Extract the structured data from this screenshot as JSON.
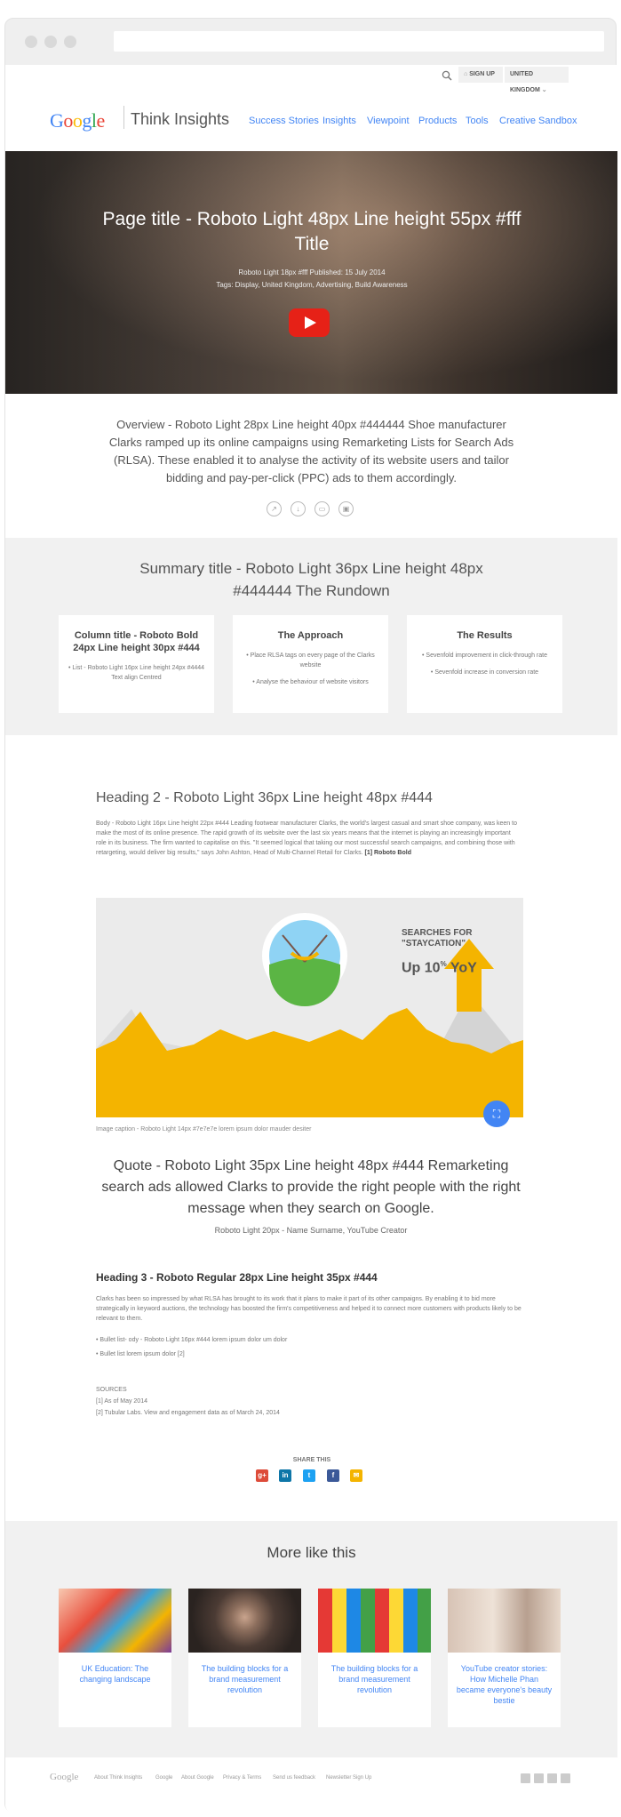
{
  "header": {
    "sign_up": "SIGN UP",
    "region": "UNITED KINGDOM",
    "logo": [
      "G",
      "o",
      "o",
      "g",
      "l",
      "e"
    ],
    "brand": "Think Insights",
    "nav": [
      "Success Stories",
      "Insights",
      "Viewpoint",
      "Products",
      "Tools",
      "Creative Sandbox"
    ]
  },
  "hero": {
    "title": "Page title - Roboto Light 48px Line height 55px #fff Title",
    "meta_line1": "Roboto Light 18px #fff Published: 15 July 2014",
    "meta_line2": "Tags: Display, United Kingdom, Advertising, Build Awareness"
  },
  "overview": "Overview - Roboto Light 28px Line height 40px #444444 Shoe manufacturer Clarks ramped up its online campaigns using Remarketing Lists for Search Ads (RLSA). These enabled it to analyse the activity of its website users and tailor bidding and pay-per-click (PPC) ads to them accordingly.",
  "summary": {
    "title": "Summary title - Roboto Light 36px Line height 48px #444444 The Rundown",
    "cards": [
      {
        "title": "Column title - Roboto Bold 24px  Line height 30px #444",
        "items": [
          "• List - Roboto Light 16px Line height 24px #4444 Text align Centred"
        ]
      },
      {
        "title": "The Approach",
        "items": [
          "• Place RLSA tags on every page of the Clarks website",
          "• Analyse the behaviour of website visitors"
        ]
      },
      {
        "title": "The Results",
        "items": [
          "• Sevenfold improvement in click-through rate",
          "• Sevenfold increase in conversion rate"
        ]
      }
    ]
  },
  "article": {
    "h2": "Heading 2 - Roboto Light 36px Line height 48px #444",
    "body": "Body - Roboto Light 16px Line height 22px #444 Leading footwear manufacturer Clarks, the world's largest casual and smart shoe company, was keen to make the most of its online presence. The rapid growth of its website over the last six years means that the internet is playing an increasingly important role in its business. The firm wanted to capitalise on this. \"It seemed logical that taking our most successful search campaigns, and combining those with retargeting, would deliver big results,\" says John Ashton, Head of Multi-Channel Retail for Clarks.",
    "body_ref": "[1] Roboto Bold",
    "infographic": {
      "label1": "SEARCHES FOR",
      "label2": "\"STAYCATION\"",
      "stat": "Up 10",
      "stat_sup": "%",
      "stat_tail": " YoY"
    },
    "caption": "Image caption - Roboto Light 14px #7e7e7e lorem ipsum dolor mauder desiter",
    "quote": "Quote - Roboto Light 35px  Line height 48px #444 Remarketing search ads allowed Clarks to provide the right people with the right message when they search on Google.",
    "quote_by": "Roboto Light 20px - Name Surname, YouTube Creator",
    "h3": "Heading 3 - Roboto Regular 28px Line height 35px #444",
    "body3": "Clarks has been so impressed by what RLSA has brought to its work that it plans to make it part of its other campaigns. By enabling it to bid more strategically in keyword auctions, the technology has boosted the firm's competitiveness and helped it to connect more customers with products likely to be relevant to them.",
    "bullet1": "• Bullet list- ody - Roboto Light 16px #444 lorem ipsum dolor um dolor",
    "bullet2": "• Bullet list lorem ipsum dolor [2]",
    "sources_label": "SOURCES",
    "source1": "[1] As of May 2014",
    "source2": "[2] Tubular Labs. View and engagement data as of March 24, 2014"
  },
  "share": {
    "label": "SHARE THIS",
    "icons": [
      "g+",
      "in",
      "t",
      "f",
      "✉"
    ],
    "colors": [
      "#dd4b39",
      "#0e76a8",
      "#1da1f2",
      "#3b5998",
      "#f4b400"
    ]
  },
  "more": {
    "title": "More like this",
    "items": [
      {
        "title": "UK Education: The changing landscape"
      },
      {
        "title": "The building blocks for a brand measurement revolution"
      },
      {
        "title": "The building blocks for a brand measurement revolution"
      },
      {
        "title": "YouTube creator stories: How Michelle Phan became everyone's beauty bestie"
      }
    ]
  },
  "footer": {
    "logo": "Google",
    "links": [
      "About Think Insights",
      "Google",
      "About Google",
      "Privacy & Terms",
      "Send us feedback",
      "Newsletter Sign Up"
    ]
  }
}
